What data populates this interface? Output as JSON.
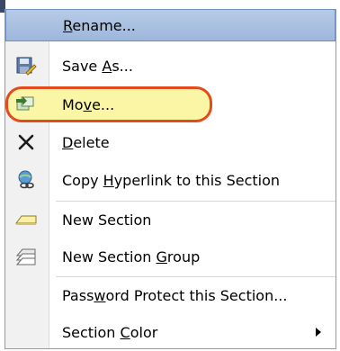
{
  "menu": {
    "items": [
      {
        "label_pre": "",
        "mnemonic": "R",
        "label_post": "ename...",
        "icon": "none",
        "state": "hover"
      },
      {
        "label_pre": "Save ",
        "mnemonic": "A",
        "label_post": "s...",
        "icon": "save-as-icon"
      },
      {
        "label_pre": "Mo",
        "mnemonic": "v",
        "label_post": "e...",
        "icon": "move-icon",
        "state": "highlighted"
      },
      {
        "label_pre": "",
        "mnemonic": "D",
        "label_post": "elete",
        "icon": "delete-x-icon"
      },
      {
        "label_pre": "Copy ",
        "mnemonic": "H",
        "label_post": "yperlink to this Section",
        "icon": "hyperlink-icon"
      },
      {
        "label_pre": "New Section",
        "mnemonic": "",
        "label_post": "",
        "icon": "new-section-icon"
      },
      {
        "label_pre": "New Section ",
        "mnemonic": "G",
        "label_post": "roup",
        "icon": "new-section-group-icon"
      },
      {
        "label_pre": "Pass",
        "mnemonic": "w",
        "label_post": "ord Protect this Section...",
        "icon": "none"
      },
      {
        "label_pre": "Section ",
        "mnemonic": "C",
        "label_post": "olor",
        "icon": "none",
        "submenu": true
      }
    ]
  },
  "colors": {
    "hover_bg": "#9db7dc",
    "highlight_ring": "#e24c1c",
    "highlight_fill": "#fbf6a5"
  }
}
